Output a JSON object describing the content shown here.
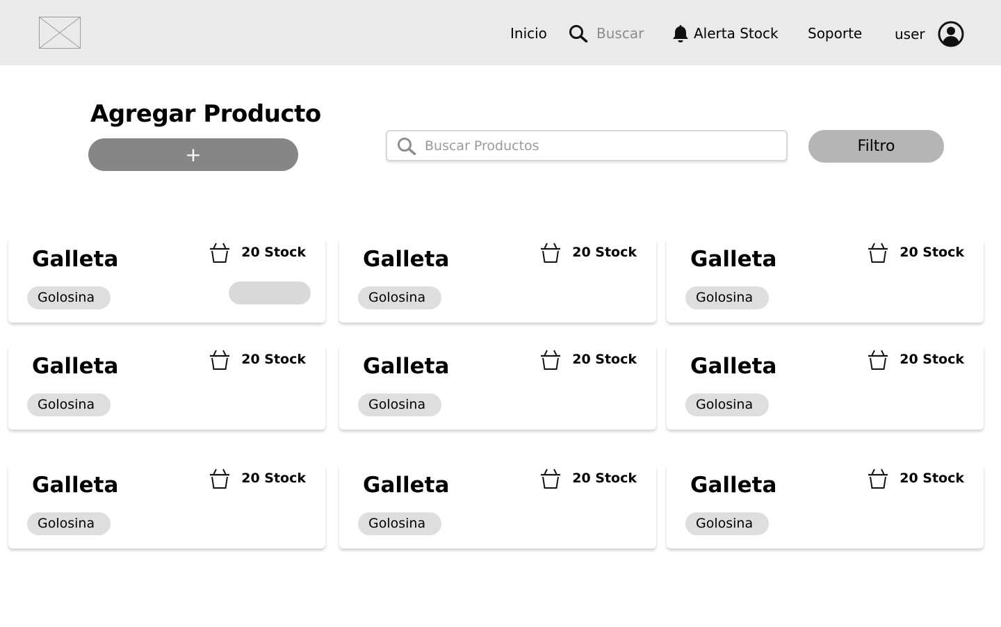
{
  "header": {
    "logo_icon": "image-placeholder-icon",
    "nav": {
      "inicio": "Inicio",
      "buscar": "Buscar",
      "alerta_stock": "Alerta Stock",
      "soporte": "Soporte",
      "user": "user"
    }
  },
  "toolbar": {
    "title": "Agregar Producto",
    "add_label": "+",
    "search_placeholder": "Buscar Productos",
    "filter_label": "Filtro"
  },
  "colors": {
    "header_bg": "#eaeaea",
    "add_button": "#868686",
    "filter_button": "#b5b5b5",
    "tag_bg": "#dedede"
  },
  "products": [
    {
      "name": "Galleta",
      "stock": "20 Stock",
      "category": "Golosina"
    },
    {
      "name": "Galleta",
      "stock": "20 Stock",
      "category": "Golosina"
    },
    {
      "name": "Galleta",
      "stock": "20 Stock",
      "category": "Golosina"
    },
    {
      "name": "Galleta",
      "stock": "20 Stock",
      "category": "Golosina"
    },
    {
      "name": "Galleta",
      "stock": "20 Stock",
      "category": "Golosina"
    },
    {
      "name": "Galleta",
      "stock": "20 Stock",
      "category": "Golosina"
    },
    {
      "name": "Galleta",
      "stock": "20 Stock",
      "category": "Golosina"
    },
    {
      "name": "Galleta",
      "stock": "20 Stock",
      "category": "Golosina"
    },
    {
      "name": "Galleta",
      "stock": "20 Stock",
      "category": "Golosina"
    }
  ]
}
